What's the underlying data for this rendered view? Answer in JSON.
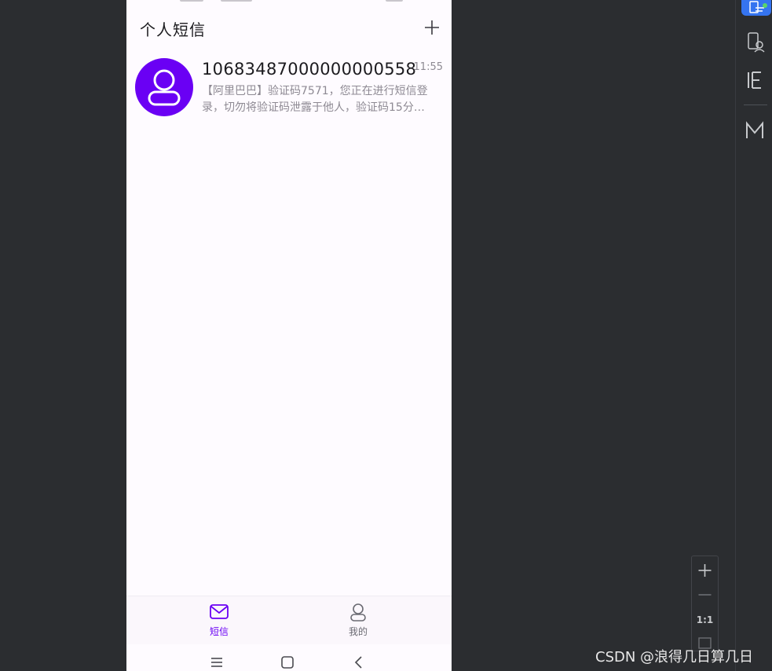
{
  "header": {
    "title": "个人短信",
    "add_icon": "plus-icon"
  },
  "messages": [
    {
      "sender": "10683487000000000558",
      "time": "11:55",
      "preview": "【阿里巴巴】验证码7571，您正在进行短信登录，切勿将验证码泄露于他人，验证码15分…",
      "avatar_icon": "person-icon"
    }
  ],
  "bottom_nav": {
    "tabs": [
      {
        "label": "短信",
        "icon": "mail-icon",
        "active": true
      },
      {
        "label": "我的",
        "icon": "person-icon",
        "active": false
      }
    ]
  },
  "system_nav": [
    "menu-icon",
    "home-icon",
    "back-icon"
  ],
  "zoom": {
    "ratio_label": "1:1"
  },
  "watermark": "CSDN @浪得几日算几日",
  "colors": {
    "accent": "#6a00f4",
    "ide_background": "#2b2d30",
    "ide_active": "#3574f0",
    "phone_background": "#fefbff"
  }
}
